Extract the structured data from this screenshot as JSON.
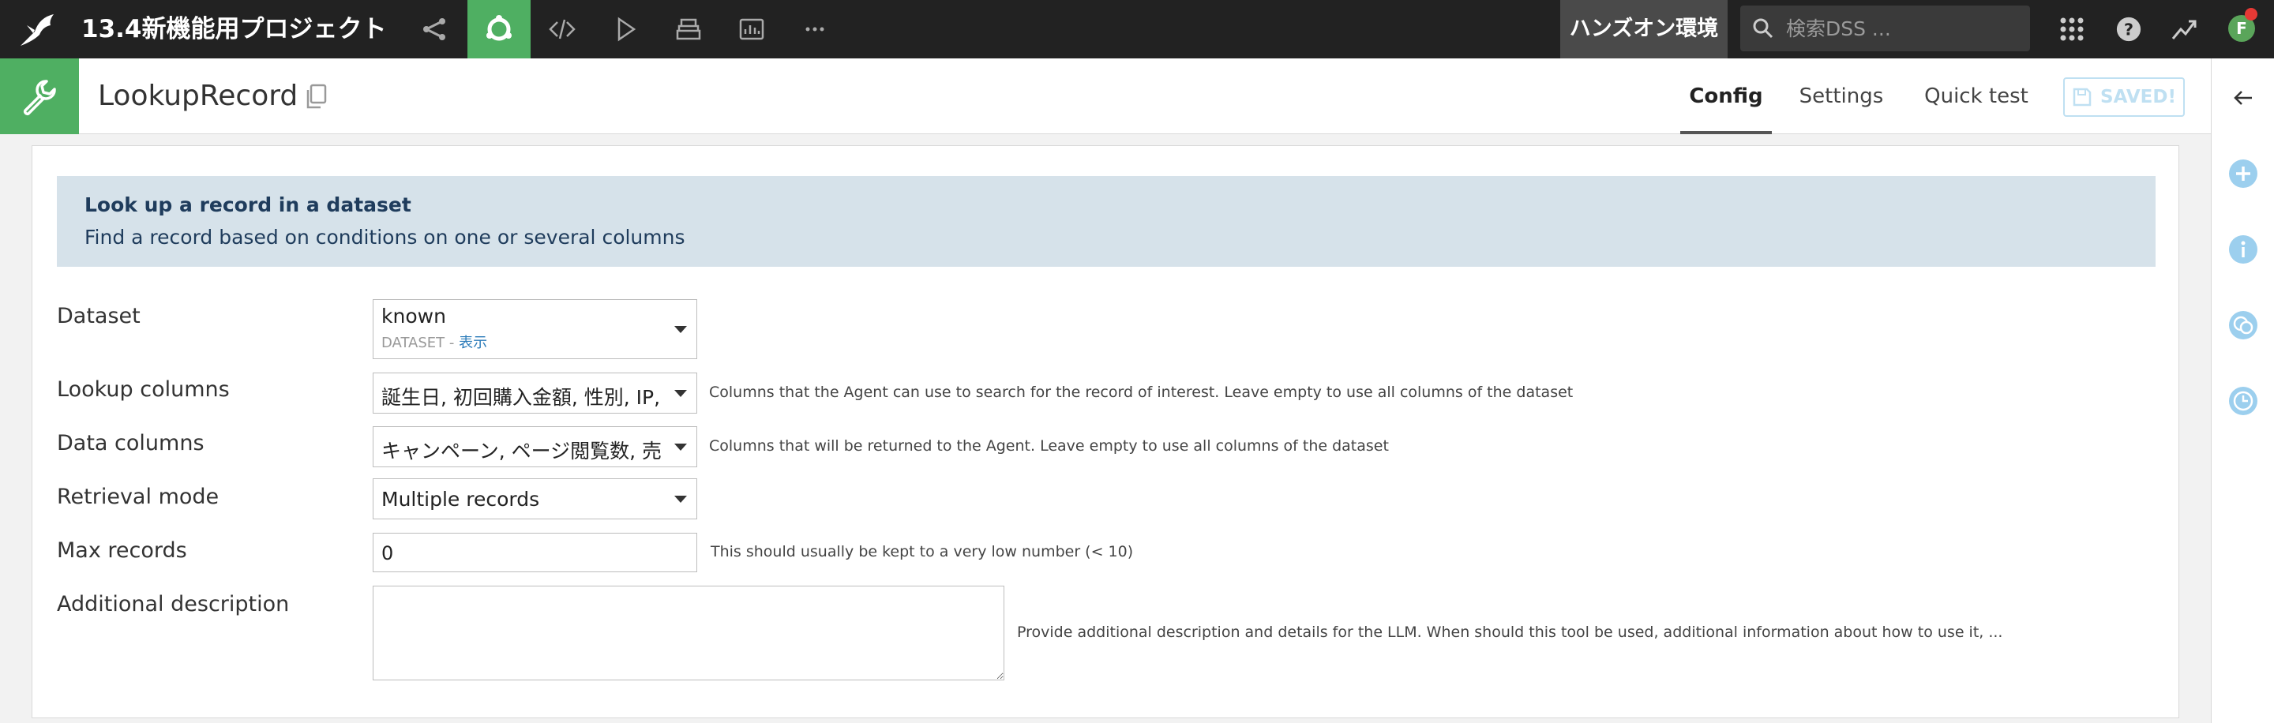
{
  "topbar": {
    "project_title": "13.4新機能用プロジェクト",
    "environment": "ハンズオン環境",
    "search_placeholder": "検索DSS ...",
    "avatar_initial": "F"
  },
  "object": {
    "name": "LookupRecord",
    "tabs": [
      "Config",
      "Settings",
      "Quick test"
    ],
    "active_tab": "Config",
    "saved_label": "SAVED!"
  },
  "info": {
    "title": "Look up a record in a dataset",
    "description": "Find a record based on conditions on one or several columns"
  },
  "form": {
    "dataset": {
      "label": "Dataset",
      "value": "known",
      "type": "DATASET",
      "separator": " - ",
      "link": "表示"
    },
    "lookup_columns": {
      "label": "Lookup columns",
      "value": "誕生日, 初回購入金額, 性別, IP,",
      "help": "Columns that the Agent can use to search for the record of interest. Leave empty to use all columns of the dataset"
    },
    "data_columns": {
      "label": "Data columns",
      "value": "キャンペーン, ページ閲覧数, 売",
      "help": "Columns that will be returned to the Agent. Leave empty to use all columns of the dataset"
    },
    "retrieval_mode": {
      "label": "Retrieval mode",
      "value": "Multiple records"
    },
    "max_records": {
      "label": "Max records",
      "value": "0",
      "help": "This should usually be kept to a very low number (< 10)"
    },
    "additional_description": {
      "label": "Additional description",
      "value": "",
      "help": "Provide additional description and details for the LLM. When should this tool be used, additional information about how to use it, ..."
    }
  },
  "colors": {
    "topbar_bg": "#222222",
    "accent_green": "#4faf62",
    "info_bg": "#d6e2ea",
    "info_text": "#1f3c5c",
    "link_blue": "#2b7bb9",
    "saved_disabled": "#bfe0f2",
    "sidebar_icon_blue": "#9ccfee"
  },
  "icons": {
    "logo": "bird-logo-icon",
    "nav": [
      "flow-icon",
      "agent-tools-icon",
      "code-icon",
      "run-icon",
      "stack-icon",
      "dashboard-icon",
      "more-icon"
    ],
    "topbar_right": [
      "search-icon",
      "apps-grid-icon",
      "help-icon",
      "trend-icon"
    ],
    "object": "wrench-icon",
    "copy": "copy-icon",
    "saved": "save-icon",
    "sidebar": [
      "back-arrow-icon",
      "add-icon",
      "info-icon",
      "discussions-icon",
      "history-icon"
    ]
  }
}
